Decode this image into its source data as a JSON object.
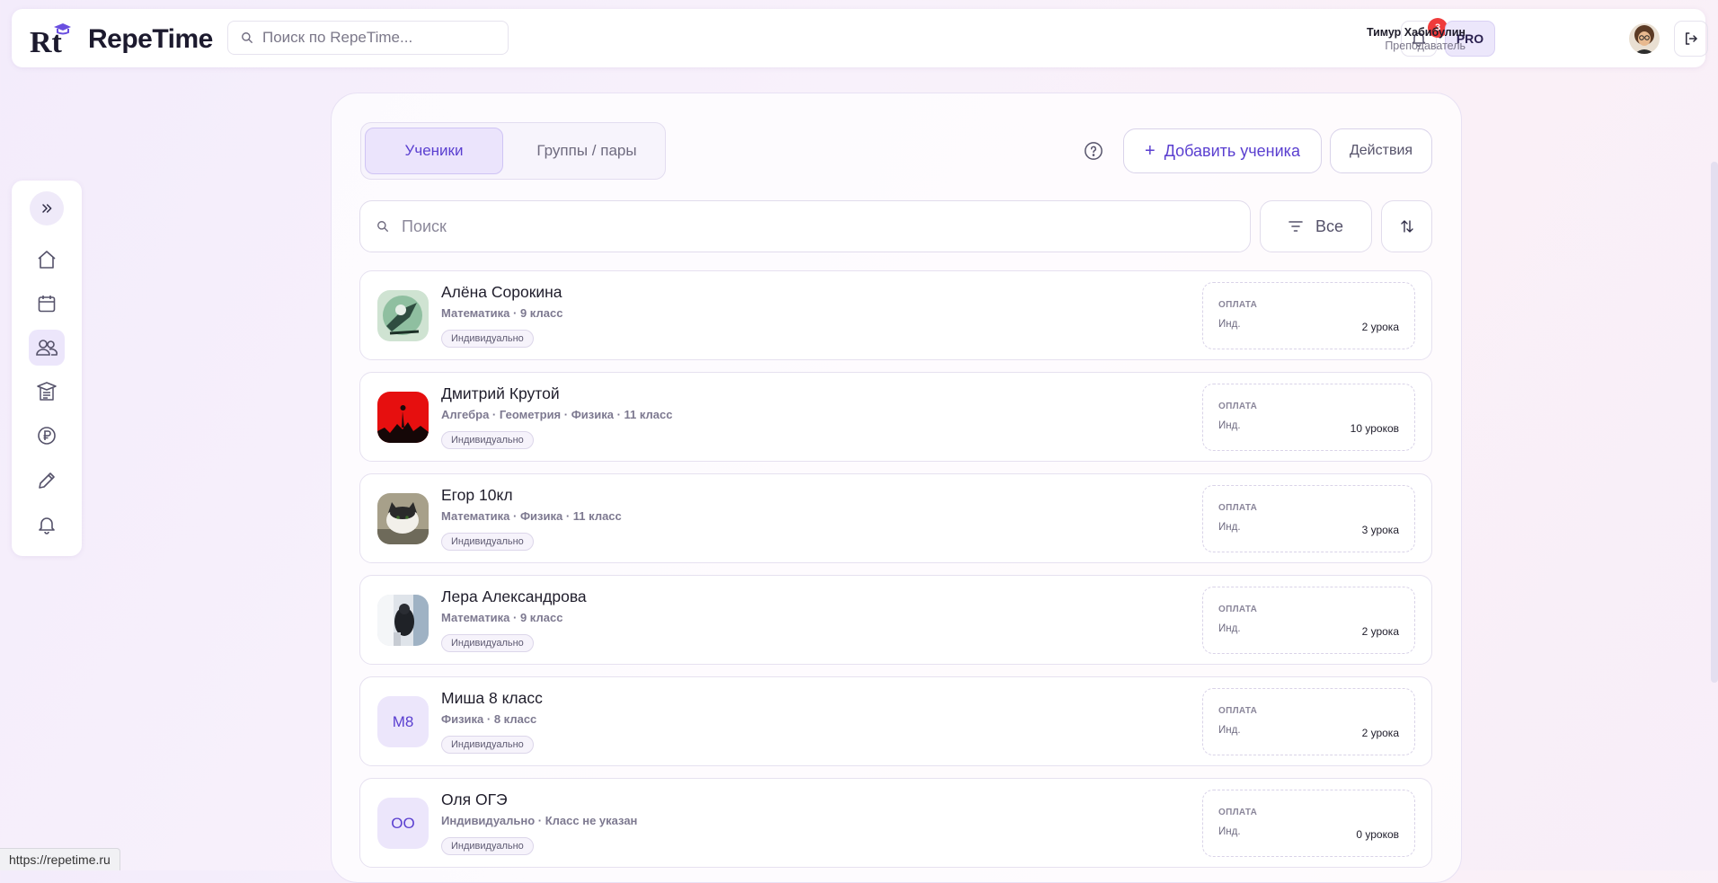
{
  "app": {
    "logo_mark": "Rt",
    "name": "RepeTime"
  },
  "header": {
    "search_placeholder": "Поиск по RepeTime...",
    "notifications_count": "3",
    "pro_label": "PRO",
    "user_name": "Тимур Хабибулин",
    "user_role": "Преподаватель"
  },
  "sidebar": {
    "items": [
      "expand",
      "home",
      "calendar",
      "students",
      "lessons",
      "payments",
      "edit",
      "notifications"
    ],
    "active": "students"
  },
  "tabs": [
    {
      "label": "Ученики",
      "active": true
    },
    {
      "label": "Группы / пары",
      "active": false
    }
  ],
  "toolbar": {
    "add_label": "Добавить ученика",
    "add_plus": "+",
    "actions_label": "Действия",
    "search_placeholder": "Поиск",
    "filter_label": "Все"
  },
  "students": [
    {
      "name": "Алёна Сорокина",
      "subjects": "Математика · 9 класс",
      "tag": "Индивидуально",
      "pay_label": "ОПЛАТА",
      "pay_kind": "Инд.",
      "pay_count": "2 урока",
      "avatar": "photo"
    },
    {
      "name": "Дмитрий Крутой",
      "subjects": "Алгебра · Геометрия · Физика · 11 класс",
      "tag": "Индивидуально",
      "pay_label": "ОПЛАТА",
      "pay_kind": "Инд.",
      "pay_count": "10 уроков",
      "avatar": "photo"
    },
    {
      "name": "Егор 10кл",
      "subjects": "Математика · Физика · 11 класс",
      "tag": "Индивидуально",
      "pay_label": "ОПЛАТА",
      "pay_kind": "Инд.",
      "pay_count": "3 урока",
      "avatar": "photo"
    },
    {
      "name": "Лера Александрова",
      "subjects": "Математика · 9 класс",
      "tag": "Индивидуально",
      "pay_label": "ОПЛАТА",
      "pay_kind": "Инд.",
      "pay_count": "2 урока",
      "avatar": "photo"
    },
    {
      "name": "Миша 8 класс",
      "subjects": "Физика · 8 класс",
      "tag": "Индивидуально",
      "pay_label": "ОПЛАТА",
      "pay_kind": "Инд.",
      "pay_count": "2 урока",
      "avatar": "initials",
      "initials": "М8"
    },
    {
      "name": "Оля ОГЭ",
      "subjects": "Индивидуально · Класс не указан",
      "tag": "Индивидуально",
      "pay_label": "ОПЛАТА",
      "pay_kind": "Инд.",
      "pay_count": "0 уроков",
      "avatar": "initials",
      "initials": "ОО"
    }
  ],
  "status_bar": {
    "url": "https://repetime.ru"
  },
  "colors": {
    "accent": "#5a3fd0",
    "badge": "#ef3b3b",
    "active_bg": "#ebe4fc"
  }
}
